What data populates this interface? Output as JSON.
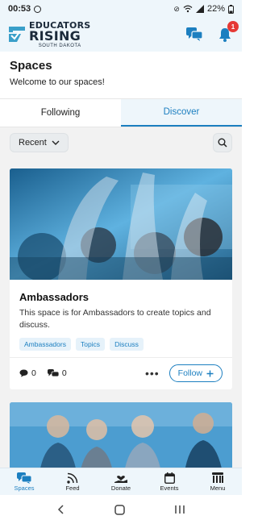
{
  "status_bar": {
    "time": "00:53",
    "battery": "22%"
  },
  "header": {
    "logo_line1": "EDUCATORS",
    "logo_line2": "RISING",
    "logo_line3": "SOUTH DAKOTA",
    "notification_count": "1"
  },
  "page": {
    "title": "Spaces",
    "subtitle": "Welcome to our spaces!"
  },
  "tabs": [
    {
      "label": "Following",
      "active": false
    },
    {
      "label": "Discover",
      "active": true
    }
  ],
  "filter": {
    "sort_label": "Recent"
  },
  "card": {
    "title": "Ambassadors",
    "description": "This space is for Ambassadors to create topics and discuss.",
    "tags": [
      "Ambassadors",
      "Topics",
      "Discuss"
    ],
    "comment_count": "0",
    "member_count": "0",
    "more_label": "•••",
    "follow_label": "Follow"
  },
  "bottom_nav": [
    {
      "label": "Spaces",
      "icon": "spaces-icon",
      "active": true
    },
    {
      "label": "Feed",
      "icon": "feed-icon",
      "active": false
    },
    {
      "label": "Donate",
      "icon": "donate-icon",
      "active": false
    },
    {
      "label": "Events",
      "icon": "calendar-icon",
      "active": false
    },
    {
      "label": "Menu",
      "icon": "menu-icon",
      "active": false
    }
  ],
  "colors": {
    "accent": "#1c7fc0",
    "header_bg": "#eef6fb",
    "badge": "#e53935"
  }
}
